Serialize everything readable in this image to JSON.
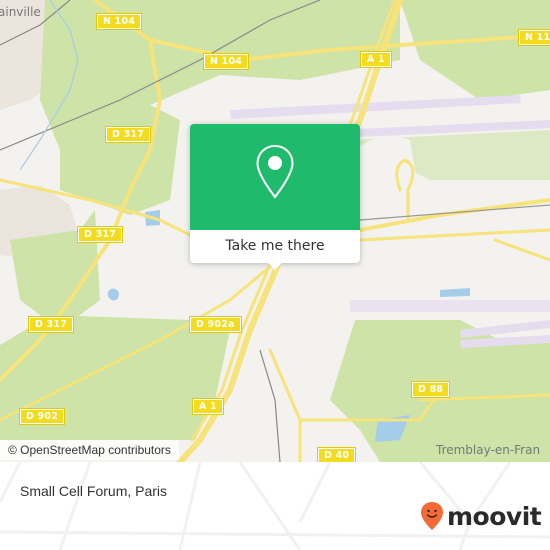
{
  "map": {
    "road_labels": [
      {
        "id": "n104-a",
        "text": "N 104"
      },
      {
        "id": "n104-b",
        "text": "N 104"
      },
      {
        "id": "a1-north",
        "text": "A 1"
      },
      {
        "id": "n11x",
        "text": "N 11"
      },
      {
        "id": "d317-a",
        "text": "D 317"
      },
      {
        "id": "d317-b",
        "text": "D 317"
      },
      {
        "id": "d317-c",
        "text": "D 317"
      },
      {
        "id": "d902a",
        "text": "D 902a"
      },
      {
        "id": "d902",
        "text": "D 902"
      },
      {
        "id": "a1-south",
        "text": "A 1"
      },
      {
        "id": "d88",
        "text": "D 88"
      },
      {
        "id": "d40",
        "text": "D 40"
      }
    ],
    "place_labels": {
      "top_left": "ainville",
      "bottom_right": "Tremblay-en-Fran"
    },
    "attribution": "© OpenStreetMap contributors",
    "colors": {
      "forest": "#cde3a8",
      "land": "#f3f2ee",
      "urban": "#ebe5de",
      "road": "#f6e37a",
      "airport": "#e5dcef",
      "water": "#a5cdea",
      "shield": "#f3dc1d"
    }
  },
  "popup": {
    "icon": "map-pin-icon",
    "button_label": "Take me there",
    "color": "#1fba6c"
  },
  "footer": {
    "title": "Small Cell Forum, Paris",
    "logo_text": "moovit",
    "logo_color": "#f26a35"
  }
}
